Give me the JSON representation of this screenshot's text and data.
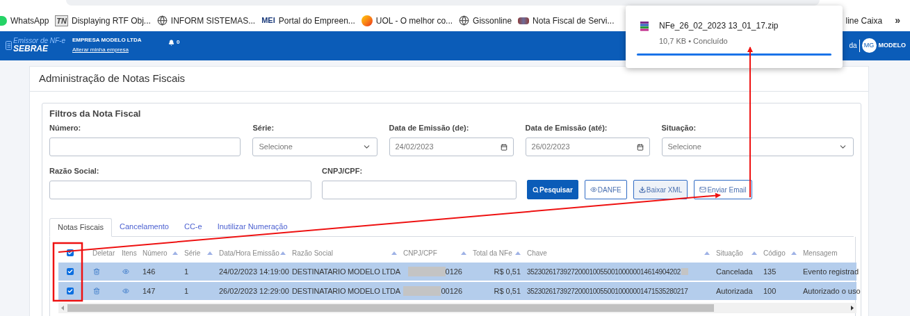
{
  "browser": {
    "bookmarks": [
      {
        "kind": "chat",
        "label": "WhatsApp"
      },
      {
        "kind": "letters",
        "icon_text": "TN",
        "label": "Displaying RTF Obj..."
      },
      {
        "kind": "globe",
        "label": "INFORM SISTEMAS..."
      },
      {
        "kind": "letters-bold",
        "icon_text": "MEI",
        "label": "Portal do Empreen..."
      },
      {
        "kind": "orb",
        "label": "UOL - O melhor co..."
      },
      {
        "kind": "globe",
        "label": "Gissonline"
      },
      {
        "kind": "crest",
        "label": "Nota Fiscal de Servi..."
      },
      {
        "kind": "none",
        "label": "line Caixa"
      }
    ],
    "more": "»"
  },
  "download_popup": {
    "file_name": "NFe_26_02_2023 13_01_17.zip",
    "details": "10,7 KB • Concluído",
    "level": 1
  },
  "app_header": {
    "logo_line_1": "Emissor de NF-e",
    "logo_line_2": "SEBRAE",
    "company": "EMPRESA MODELO LTDA",
    "company_link": "Alterar minha empresa",
    "notifications": "0",
    "user_partial": "da",
    "avatar": "MG",
    "user": "MODELO"
  },
  "page_title": "Administração de Notas Fiscais",
  "filters": {
    "title": "Filtros da Nota Fiscal",
    "fields": [
      {
        "label": "Número:",
        "kind": "text"
      },
      {
        "label": "Série:",
        "kind": "select",
        "value": "Selecione"
      },
      {
        "label": "Data de Emissão (de):",
        "kind": "date",
        "value": "24/02/2023"
      },
      {
        "label": "Data de Emissão (até):",
        "kind": "date",
        "value": "26/02/2023"
      },
      {
        "label": "Situação:",
        "kind": "select",
        "value": "Selecione"
      },
      {
        "label": "Razão Social:",
        "kind": "text"
      },
      {
        "label": "CNPJ/CPF:",
        "kind": "text"
      }
    ],
    "actions": [
      {
        "label": "Pesquisar",
        "kind": "primary"
      },
      {
        "label": "DANFE",
        "kind": "outline"
      },
      {
        "label": "Baixar XML",
        "kind": "muted"
      },
      {
        "label": "Enviar Email",
        "kind": "outline"
      }
    ]
  },
  "tabs": [
    {
      "label": "Notas Fiscais",
      "selected": true
    },
    {
      "label": "Cancelamento",
      "selected": false
    },
    {
      "label": "CC-e",
      "selected": false
    },
    {
      "label": "Inutilizar Numeração",
      "selected": false
    }
  ],
  "table": {
    "select_all_checked": true,
    "columns": [
      {
        "label": "Deletar",
        "sortable": false
      },
      {
        "label": "Itens",
        "sortable": false
      },
      {
        "label": "Número",
        "sortable": true
      },
      {
        "label": "Série",
        "sortable": true
      },
      {
        "label": "Data/Hora Emissão",
        "sortable": true
      },
      {
        "label": "Razão Social",
        "sortable": true
      },
      {
        "label": "CNPJ/CPF",
        "sortable": true
      },
      {
        "label": "Total da NFe",
        "sortable": true
      },
      {
        "label": "Chave",
        "sortable": true
      },
      {
        "label": "Situação",
        "sortable": true
      },
      {
        "label": "Código",
        "sortable": true
      },
      {
        "label": "Mensagem",
        "sortable": false
      }
    ],
    "rows": [
      {
        "checked": true,
        "selected": true,
        "numero": "146",
        "serie": "1",
        "data": "24/02/2023 14:19:00",
        "razao": "DESTINATARIO MODELO LTDA",
        "cnpj": "0126",
        "total": "R$ 0,51",
        "chave": "352302617392720001005500100000014614904202",
        "chave_hidden": true,
        "situacao": "Cancelada",
        "codigo": "135",
        "mensagem": "Evento registrad"
      },
      {
        "checked": true,
        "selected": true,
        "numero": "147",
        "serie": "1",
        "data": "26/02/2023 12:29:00",
        "razao": "DESTINATARIO MODELO LTDA",
        "cnpj": "00126",
        "total": "R$ 0,51",
        "chave": "35230261739272000100550010000001471535280217",
        "chave_hidden": false,
        "situacao": "Autorizada",
        "codigo": "100",
        "mensagem": "Autorizado o uso"
      }
    ]
  }
}
